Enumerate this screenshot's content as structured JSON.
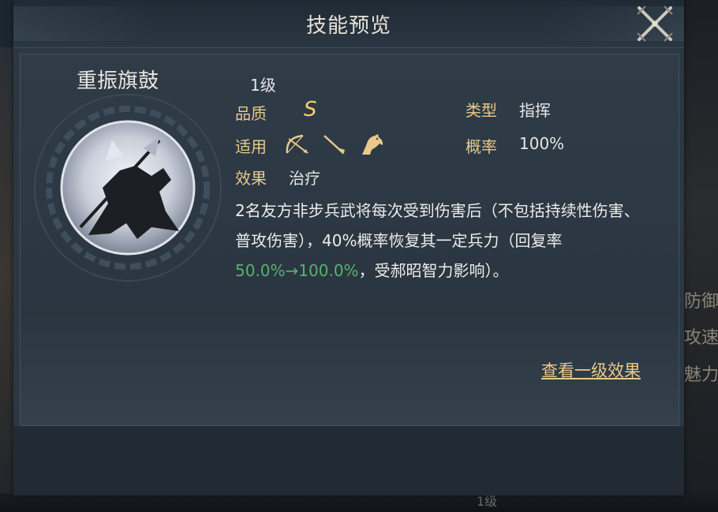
{
  "background": {
    "right_labels": [
      "防御",
      "攻速",
      "魅力"
    ],
    "bottom_level": "1级"
  },
  "dialog": {
    "title": "技能预览",
    "close_icon": "crossed-swords-close-icon"
  },
  "skill": {
    "name": "重振旗鼓",
    "icon": "warrior-charge-skill-icon",
    "level": "1级",
    "grade_label": "品质",
    "grade_value": "S",
    "type_label": "类型",
    "type_value": "指挥",
    "applicable_label": "适用",
    "applicable_icons": [
      "bow-archer-icon",
      "spear-infantry-icon",
      "horse-cavalry-icon"
    ],
    "rate_label": "概率",
    "rate_value": "100%",
    "effect_label": "效果",
    "effect_value": "治疗",
    "description": {
      "part1": "2名友方非步兵武将每次受到伤害后（不包括持续性伤害、普攻伤害），40%概率恢复其一定兵力（回复率",
      "highlight": "50.0%→100.0%",
      "part2": "，受郝昭智力影响）。"
    },
    "view_level1_link": "查看一级效果"
  },
  "colors": {
    "label": "#e8c98a",
    "grade": "#f2d36b",
    "highlight": "#56b36e",
    "panel": "#2b3742"
  }
}
